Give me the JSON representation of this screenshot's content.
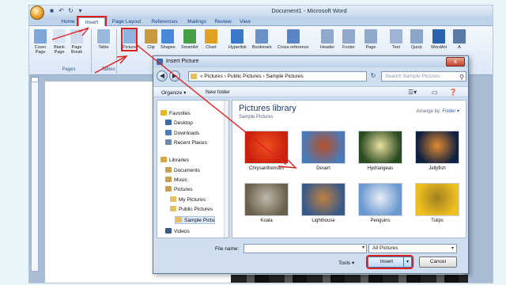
{
  "window": {
    "title": "Document1 - Microsoft Word"
  },
  "ribbon": {
    "tabs": [
      "Home",
      "Insert",
      "Page Layout",
      "References",
      "Mailings",
      "Review",
      "View"
    ],
    "active_tab": "Insert",
    "buttons": [
      {
        "label": "Cover\nPage",
        "icon": "cover-page-icon"
      },
      {
        "label": "Blank\nPage",
        "icon": "blank-page-icon"
      },
      {
        "label": "Page\nBreak",
        "icon": "page-break-icon"
      },
      {
        "label": "Table",
        "icon": "table-icon"
      },
      {
        "label": "Picture",
        "icon": "picture-icon"
      },
      {
        "label": "Clip",
        "icon": "clip-art-icon"
      },
      {
        "label": "Shapes",
        "icon": "shapes-icon"
      },
      {
        "label": "SmartArt",
        "icon": "smartart-icon"
      },
      {
        "label": "Chart",
        "icon": "chart-icon"
      },
      {
        "label": "Hyperlink",
        "icon": "hyperlink-icon"
      },
      {
        "label": "Bookmark",
        "icon": "bookmark-icon"
      },
      {
        "label": "Cross-reference",
        "icon": "cross-reference-icon"
      },
      {
        "label": "Header",
        "icon": "header-icon"
      },
      {
        "label": "Footer",
        "icon": "footer-icon"
      },
      {
        "label": "Page",
        "icon": "page-number-icon"
      },
      {
        "label": "Text",
        "icon": "text-box-icon"
      },
      {
        "label": "Quick",
        "icon": "quick-parts-icon"
      },
      {
        "label": "WordArt",
        "icon": "wordart-icon"
      },
      {
        "label": "A",
        "icon": "drop-cap-icon"
      }
    ],
    "groups": [
      "Pages",
      "Tables"
    ]
  },
  "dialog": {
    "title": "Insert Picture",
    "close_label": "x",
    "address": "« Pictures › Public Pictures › Sample Pictures",
    "search_placeholder": "Search Sample Pictures",
    "toolbar": {
      "organize": "Organize ▾",
      "new_folder": "New folder"
    },
    "nav": [
      {
        "label": "Favorites",
        "level": 0,
        "icon": "star-icon"
      },
      {
        "label": "Desktop",
        "level": 1,
        "icon": "desktop-icon"
      },
      {
        "label": "Downloads",
        "level": 1,
        "icon": "downloads-icon"
      },
      {
        "label": "Recent Places",
        "level": 1,
        "icon": "recent-places-icon"
      },
      {
        "label": "Libraries",
        "level": 0,
        "icon": "libraries-icon"
      },
      {
        "label": "Documents",
        "level": 1,
        "icon": "documents-icon"
      },
      {
        "label": "Music",
        "level": 1,
        "icon": "music-icon"
      },
      {
        "label": "Pictures",
        "level": 1,
        "icon": "pictures-icon"
      },
      {
        "label": "My Pictures",
        "level": 2,
        "icon": "folder-icon"
      },
      {
        "label": "Public Pictures",
        "level": 2,
        "icon": "folder-icon"
      },
      {
        "label": "Sample Pictu",
        "level": 3,
        "icon": "folder-icon",
        "selected": true
      },
      {
        "label": "Videos",
        "level": 1,
        "icon": "videos-icon"
      }
    ],
    "library_title": "Pictures library",
    "library_sub": "Sample Pictures",
    "arrange_label": "Arrange by:",
    "arrange_value": "Folder ▾",
    "pictures": [
      {
        "name": "Chrysanthemum",
        "colors": [
          "#c8200c",
          "#f05020"
        ]
      },
      {
        "name": "Desert",
        "colors": [
          "#4a7ab8",
          "#b8502a"
        ]
      },
      {
        "name": "Hydrangeas",
        "colors": [
          "#2a4a20",
          "#e8e0a0"
        ]
      },
      {
        "name": "Jellyfish",
        "colors": [
          "#102040",
          "#e08a30"
        ]
      },
      {
        "name": "Koala",
        "colors": [
          "#6a6050",
          "#c0b8a8"
        ]
      },
      {
        "name": "Lighthouse",
        "colors": [
          "#3a5a88",
          "#c08040"
        ]
      },
      {
        "name": "Penguins",
        "colors": [
          "#6a98d0",
          "#e8eef6"
        ]
      },
      {
        "name": "Tulips",
        "colors": [
          "#f0c020",
          "#a08020"
        ]
      }
    ],
    "file_name_label": "File name:",
    "file_name_value": "",
    "file_type": "All Pictures",
    "tools_label": "Tools ▾",
    "insert_label": "Insert",
    "cancel_label": "Cancel"
  },
  "highlight_color": "#e02020"
}
